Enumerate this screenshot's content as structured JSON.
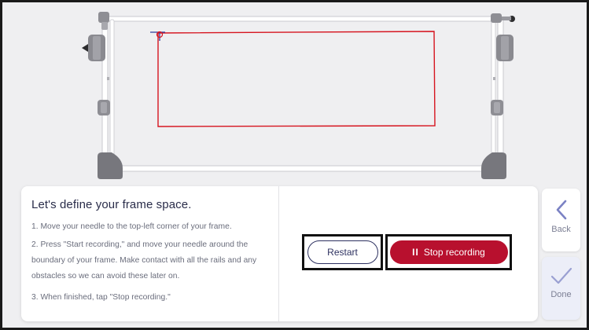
{
  "instructions": {
    "title": "Let's define your frame space.",
    "steps": [
      "1. Move your needle to the top-left corner of your frame.",
      "2. Press \"Start recording,\" and move your needle around the boundary of your frame. Make contact with all the rails and any obstacles so we can avoid these later on.",
      "3. When finished, tap \"Stop recording.\""
    ]
  },
  "controls": {
    "restart_label": "Restart",
    "stop_label": "Stop recording",
    "stop_icon": "pause-icon"
  },
  "nav": {
    "back_label": "Back",
    "back_icon": "chevron-left-icon",
    "done_label": "Done",
    "done_icon": "checkmark-icon"
  },
  "colors": {
    "boundary": "#d6141f",
    "needle_marker": "#2f3a9c",
    "stop_button": "#b8102e",
    "title_text": "#2a2d4a"
  }
}
